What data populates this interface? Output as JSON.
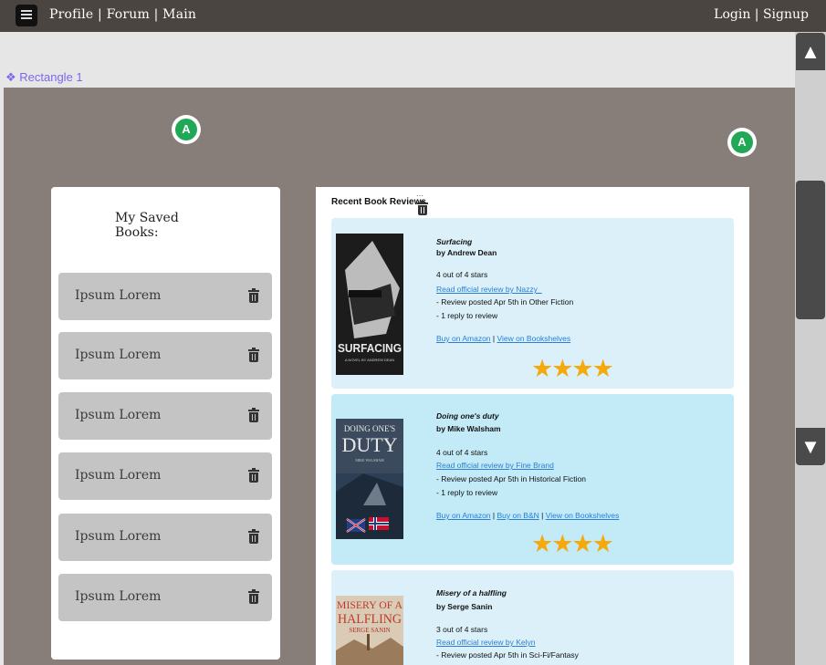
{
  "header": {
    "nav_left": "Profile | Forum | Main",
    "nav_right": "Login |  Signup"
  },
  "frame_label": "❖ Rectangle 1",
  "markers": [
    "A",
    "A"
  ],
  "saved_books": {
    "title": "My Saved Books:",
    "items": [
      "Ipsum Lorem",
      "Ipsum Lorem",
      "Ipsum Lorem",
      "Ipsum Lorem",
      "Ipsum Lorem",
      "Ipsum Lorem"
    ]
  },
  "recent_reviews": {
    "title": "Recent Book Reviews",
    "reviews": [
      {
        "title": "Surfacing",
        "author": "by Andrew Dean",
        "rating": "4 out of 4 stars",
        "review_link": "Read official review by Nazzy_",
        "posted": " - Review posted Apr 5th in Other Fiction",
        "replies": " - 1 reply to review",
        "buy_links": [
          "Buy on Amazon",
          "View on Bookshelves"
        ],
        "stars": "★★★★",
        "cover_title": "SURFACING",
        "cover_subtitle": "A NOVEL BY ANDREW DEAN",
        "bg": "#dbf0f9"
      },
      {
        "title": "Doing one's duty",
        "author": "by Mike Walsham",
        "rating": "4 out of 4 stars",
        "review_link": "Read official review by Fine Brand",
        "posted": " - Review posted Apr 5th in Historical Fiction",
        "replies": " - 1 reply to review",
        "buy_links": [
          "Buy on Amazon",
          "Buy on B&N",
          "View on Bookshelves"
        ],
        "stars": "★★★★",
        "cover_title": "DOING ONE'S",
        "cover_title2": "DUTY",
        "cover_subtitle": "MIKE WALSHAM",
        "bg": "#c3eaf7"
      },
      {
        "title": "Misery of a halfling",
        "author": "by Serge Sanin",
        "rating": "3 out of 4 stars",
        "review_link": "Read official review by Kelyn",
        "posted": " - Review posted Apr 5th in Sci-Fi/Fantasy",
        "cover_title": "MISERY OF A",
        "cover_title2": "HALFLING",
        "cover_subtitle": "SERGE SANIN",
        "bg": "#dbf0f9"
      }
    ]
  },
  "colors": {
    "topbar": "#4a4540",
    "canvas": "#877e79",
    "marker": "#21a857",
    "link": "#2a7fd4",
    "stars": "#f5a90b"
  }
}
